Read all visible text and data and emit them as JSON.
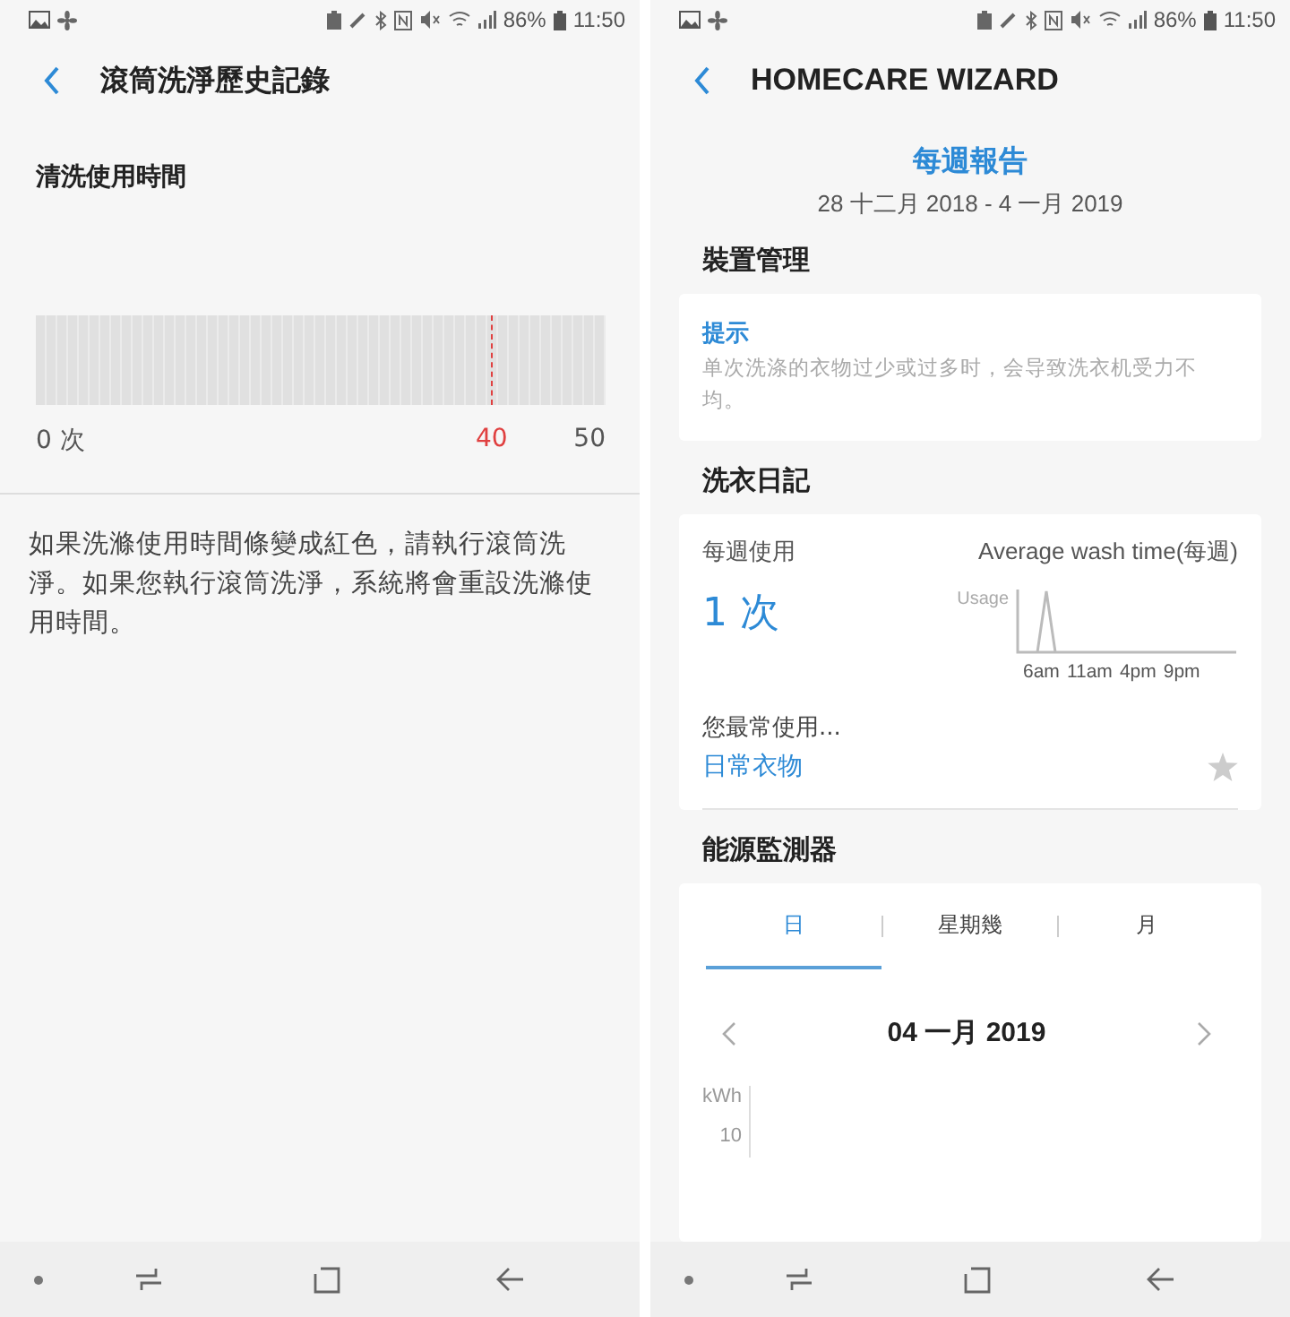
{
  "left_screen": {
    "status_bar": {
      "battery": "86%",
      "time": "11:50"
    },
    "title": "滾筒洗淨歷史記錄",
    "section_title": "清洗使用時間",
    "gauge": {
      "min_label": "0 次",
      "warning": {
        "label": "40",
        "level": 0.8
      },
      "max_label": "50"
    },
    "note": "如果洗滌使用時間條變成紅色，請執行滾筒洗淨。如果您執行滾筒洗淨，系統將會重設洗滌使用時間。"
  },
  "right_screen": {
    "status_bar": {
      "battery": "86%",
      "time": "11:50"
    },
    "title": "HOMECARE WIZARD",
    "report_title": "每週報告",
    "date_range": "28 十二月 2018 - 4 一月 2019",
    "device_section": {
      "title": "裝置管理",
      "tip_title": "提示",
      "tip_text": "单次洗涤的衣物过少或过多时，会导致洗衣机受力不均。"
    },
    "laundry_section": {
      "title": "洗衣日記",
      "weekly_label": "每週使用",
      "weekly_value": "1 次",
      "chart_title": "Average wash time(每週)",
      "chart_ylabel": "Usage",
      "chart_xlabels": [
        "6am",
        "11am",
        "4pm",
        "9pm"
      ],
      "favorite_label": "您最常使用...",
      "favorite_value": "日常衣物",
      "favorite_starred": false
    },
    "energy_section": {
      "title": "能源監測器",
      "tabs": [
        {
          "label": "日",
          "selected": true
        },
        {
          "label": "星期幾",
          "selected": false
        },
        {
          "label": "月",
          "selected": false
        }
      ],
      "date": "04 一月 2019",
      "unit": "kWh",
      "tick": "10"
    }
  }
}
